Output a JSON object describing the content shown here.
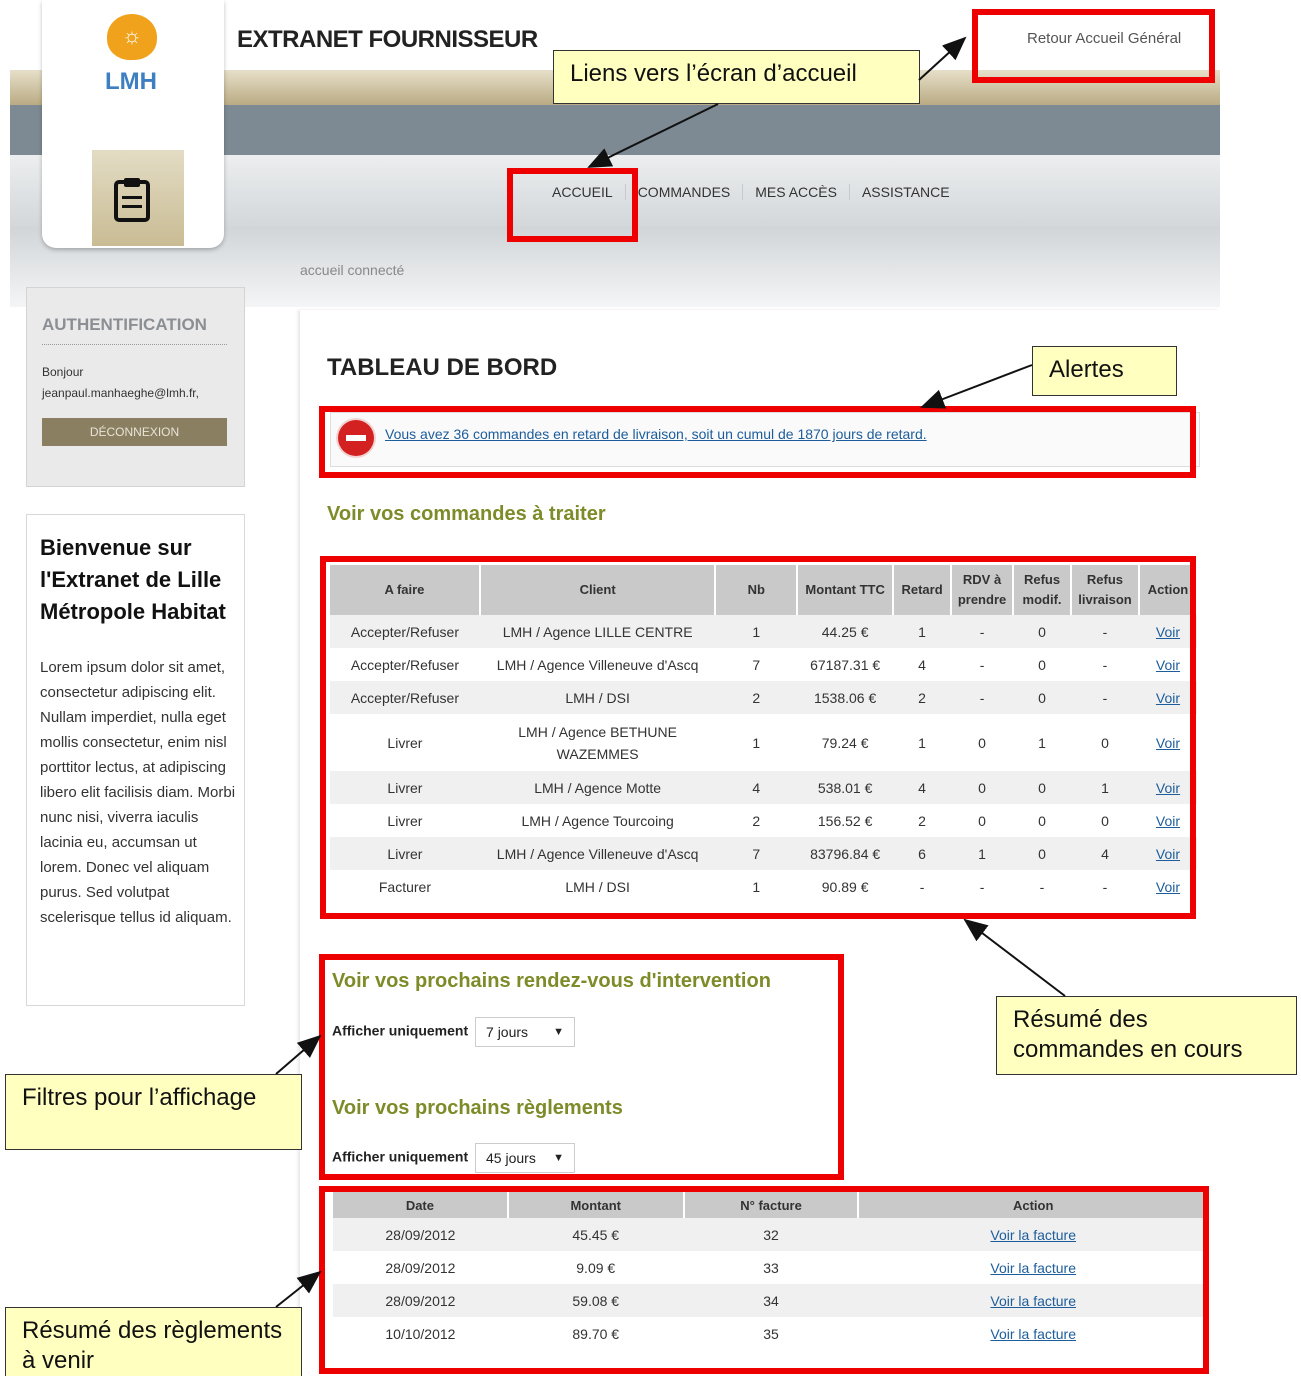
{
  "header": {
    "logo_text": "LMH",
    "title": "EXTRANET FOURNISSEUR",
    "return_link": "Retour Accueil Général",
    "nav": [
      "ACCUEIL",
      "COMMANDES",
      "MES ACCÈS",
      "ASSISTANCE"
    ],
    "breadcrumb": "accueil connecté",
    "logo_icon": "lightbulb-icon",
    "section_icon": "clipboard-icon"
  },
  "auth": {
    "title": "AUTHENTIFICATION",
    "greeting": "Bonjour",
    "user": "jeanpaul.manhaeghe@lmh.fr,",
    "logout": "DÉCONNEXION"
  },
  "welcome": {
    "title": "Bienvenue sur l'Extranet de Lille Métropole Habitat",
    "body": "Lorem ipsum dolor sit amet, consectetur adipiscing elit. Nullam imperdiet, nulla eget mollis consectetur, enim nisl porttitor lectus, at adipiscing libero elit facilisis diam. Morbi nunc nisi, viverra iaculis lacinia eu, accumsan ut lorem. Donec vel aliquam purus. Sed volutpat scelerisque tellus id aliquam."
  },
  "dashboard": {
    "title": "TABLEAU DE BORD",
    "alert": "Vous avez 36 commandes en retard de livraison, soit un cumul de 1870 jours de retard.",
    "orders_heading": "Voir vos commandes à traiter",
    "orders_columns": [
      "A faire",
      "Client",
      "Nb",
      "Montant TTC",
      "Retard",
      "RDV à prendre",
      "Refus modif.",
      "Refus livraison",
      "Action"
    ],
    "orders": [
      [
        "Accepter/Refuser",
        "LMH / Agence LILLE CENTRE",
        "1",
        "44.25 €",
        "1",
        "-",
        "0",
        "-",
        "Voir"
      ],
      [
        "Accepter/Refuser",
        "LMH / Agence Villeneuve d'Ascq",
        "7",
        "67187.31 €",
        "4",
        "-",
        "0",
        "-",
        "Voir"
      ],
      [
        "Accepter/Refuser",
        "LMH / DSI",
        "2",
        "1538.06 €",
        "2",
        "-",
        "0",
        "-",
        "Voir"
      ],
      [
        "Livrer",
        "LMH / Agence BETHUNE WAZEMMES",
        "1",
        "79.24 €",
        "1",
        "0",
        "1",
        "0",
        "Voir"
      ],
      [
        "Livrer",
        "LMH / Agence Motte",
        "4",
        "538.01 €",
        "4",
        "0",
        "0",
        "1",
        "Voir"
      ],
      [
        "Livrer",
        "LMH / Agence Tourcoing",
        "2",
        "156.52 €",
        "2",
        "0",
        "0",
        "0",
        "Voir"
      ],
      [
        "Livrer",
        "LMH / Agence Villeneuve d'Ascq",
        "7",
        "83796.84 €",
        "6",
        "1",
        "0",
        "4",
        "Voir"
      ],
      [
        "Facturer",
        "LMH / DSI",
        "1",
        "90.89 €",
        "-",
        "-",
        "-",
        "-",
        "Voir"
      ]
    ],
    "rdv_heading": "Voir vos prochains rendez-vous d'intervention",
    "filter_label": "Afficher uniquement",
    "rdv_filter": "7 jours",
    "payments_heading": "Voir vos prochains règlements",
    "payments_filter": "45 jours",
    "payments_columns": [
      "Date",
      "Montant",
      "N° facture",
      "Action"
    ],
    "payments": [
      [
        "28/09/2012",
        "45.45 €",
        "32",
        "Voir la facture"
      ],
      [
        "28/09/2012",
        "9.09 €",
        "33",
        "Voir la facture"
      ],
      [
        "28/09/2012",
        "59.08 €",
        "34",
        "Voir la facture"
      ],
      [
        "10/10/2012",
        "89.70 €",
        "35",
        "Voir la facture"
      ]
    ]
  },
  "callouts": {
    "home_links": "Liens vers l’écran d’accueil",
    "alerts": "Alertes",
    "orders_summary": "Résumé des commandes en cours",
    "filters": "Filtres pour l’affichage",
    "payments_summary": "Résumé des règlements à venir"
  },
  "colors": {
    "highlight": "#ee0000",
    "callout_bg": "#ffffc0",
    "section_heading": "#7d8b28",
    "link": "#1d5d9b"
  }
}
